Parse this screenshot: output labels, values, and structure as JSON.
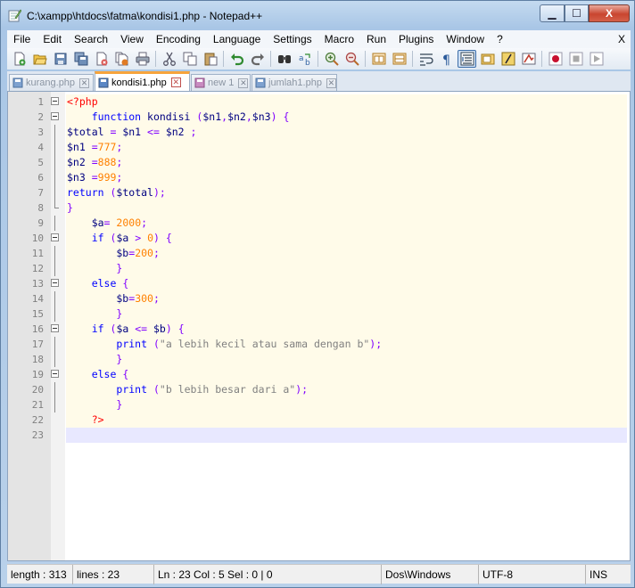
{
  "window": {
    "title": "C:\\xampp\\htdocs\\fatma\\kondisi1.php - Notepad++",
    "min_label": "▁",
    "max_label": "☐",
    "close_label": "X"
  },
  "menu": {
    "items": [
      "File",
      "Edit",
      "Search",
      "View",
      "Encoding",
      "Language",
      "Settings",
      "Macro",
      "Run",
      "Plugins",
      "Window",
      "?"
    ],
    "close_label": "X"
  },
  "toolbar": {
    "icons": [
      "new-file-icon",
      "open-file-icon",
      "save-icon",
      "save-all-icon",
      "close-icon",
      "close-all-icon",
      "print-icon",
      "cut-icon",
      "copy-icon",
      "paste-icon",
      "undo-icon",
      "redo-icon",
      "find-icon",
      "replace-icon",
      "zoom-in-icon",
      "zoom-out-icon",
      "sync-vertical-icon",
      "sync-horizontal-icon",
      "word-wrap-icon",
      "show-all-chars-icon",
      "indent-guide-icon",
      "doc-map-icon",
      "function-list-icon",
      "folder-workspace-icon",
      "monitoring-icon",
      "record-macro-icon",
      "stop-macro-icon",
      "play-macro-icon"
    ]
  },
  "tabs": [
    {
      "label": "kurang.php",
      "active": false,
      "close": "✕"
    },
    {
      "label": "kondisi1.php",
      "active": true,
      "close": "✕"
    },
    {
      "label": "new 1",
      "active": false,
      "close": "✕"
    },
    {
      "label": "jumlah1.php",
      "active": false,
      "close": "✕"
    }
  ],
  "code_lines": [
    {
      "n": "1",
      "html": "<span class='tag'>&lt;?php</span>"
    },
    {
      "n": "2",
      "html": "    <span class='kw'>function</span> kondisi <span class='op'>(</span>$n1<span class='op'>,</span>$n2<span class='op'>,</span>$n3<span class='op'>)</span> <span class='op'>{</span>"
    },
    {
      "n": "3",
      "html": "$total <span class='op'>=</span> $n1 <span class='op'>&lt;=</span> $n2 <span class='op'>;</span>"
    },
    {
      "n": "4",
      "html": "$n1 <span class='op'>=</span><span class='num'>777</span><span class='op'>;</span>"
    },
    {
      "n": "5",
      "html": "$n2 <span class='op'>=</span><span class='num'>888</span><span class='op'>;</span>"
    },
    {
      "n": "6",
      "html": "$n3 <span class='op'>=</span><span class='num'>999</span><span class='op'>;</span>"
    },
    {
      "n": "7",
      "html": "<span class='kw'>return</span> <span class='op'>(</span>$total<span class='op'>);</span>"
    },
    {
      "n": "8",
      "html": "<span class='op'>}</span>"
    },
    {
      "n": "9",
      "html": "    $a<span class='op'>=</span> <span class='num'>2000</span><span class='op'>;</span>"
    },
    {
      "n": "10",
      "html": "    <span class='kw'>if</span> <span class='op'>(</span>$a <span class='op'>&gt;</span> <span class='num'>0</span><span class='op'>)</span> <span class='op'>{</span>"
    },
    {
      "n": "11",
      "html": "        $b<span class='op'>=</span><span class='num'>200</span><span class='op'>;</span>"
    },
    {
      "n": "12",
      "html": "        <span class='op'>}</span>"
    },
    {
      "n": "13",
      "html": "    <span class='kw'>else</span> <span class='op'>{</span>"
    },
    {
      "n": "14",
      "html": "        $b<span class='op'>=</span><span class='num'>300</span><span class='op'>;</span>"
    },
    {
      "n": "15",
      "html": "        <span class='op'>}</span>"
    },
    {
      "n": "16",
      "html": "    <span class='kw'>if</span> <span class='op'>(</span>$a <span class='op'>&lt;=</span> $b<span class='op'>)</span> <span class='op'>{</span>"
    },
    {
      "n": "17",
      "html": "        <span class='kw'>print</span> <span class='op'>(</span><span class='str'>\"a lebih kecil atau sama dengan b\"</span><span class='op'>);</span>"
    },
    {
      "n": "18",
      "html": "        <span class='op'>}</span>"
    },
    {
      "n": "19",
      "html": "    <span class='kw'>else</span> <span class='op'>{</span>"
    },
    {
      "n": "20",
      "html": "        <span class='kw'>print</span> <span class='op'>(</span><span class='str'>\"b lebih besar dari a\"</span><span class='op'>);</span>"
    },
    {
      "n": "21",
      "html": "        <span class='op'>}</span>"
    },
    {
      "n": "22",
      "html": "    <span class='tag'>?&gt;</span>"
    },
    {
      "n": "23",
      "html": ""
    }
  ],
  "code_text": [
    "<?php",
    "    function kondisi ($n1,$n2,$n3) {",
    "$total = $n1 <= $n2 ;",
    "$n1 =777;",
    "$n2 =888;",
    "$n3 =999;",
    "return ($total);",
    "}",
    "    $a= 2000;",
    "    if ($a > 0) {",
    "        $b=200;",
    "        }",
    "    else {",
    "        $b=300;",
    "        }",
    "    if ($a <= $b) {",
    "        print (\"a lebih kecil atau sama dengan b\");",
    "        }",
    "    else {",
    "        print (\"b lebih besar dari a\");",
    "        }",
    "    ?>",
    ""
  ],
  "status": {
    "length": "length : 313",
    "lines": "lines : 23",
    "position": "Ln : 23   Col : 5   Sel : 0 | 0",
    "eol": "Dos\\Windows",
    "encoding": "UTF-8",
    "mode": "INS"
  },
  "colors": {
    "keyword": "#0000ff",
    "php_tag": "#ff0000",
    "number": "#ff8000",
    "string": "#808080",
    "operator": "#8000ff",
    "active_tab_accent": "#f7a43c"
  }
}
